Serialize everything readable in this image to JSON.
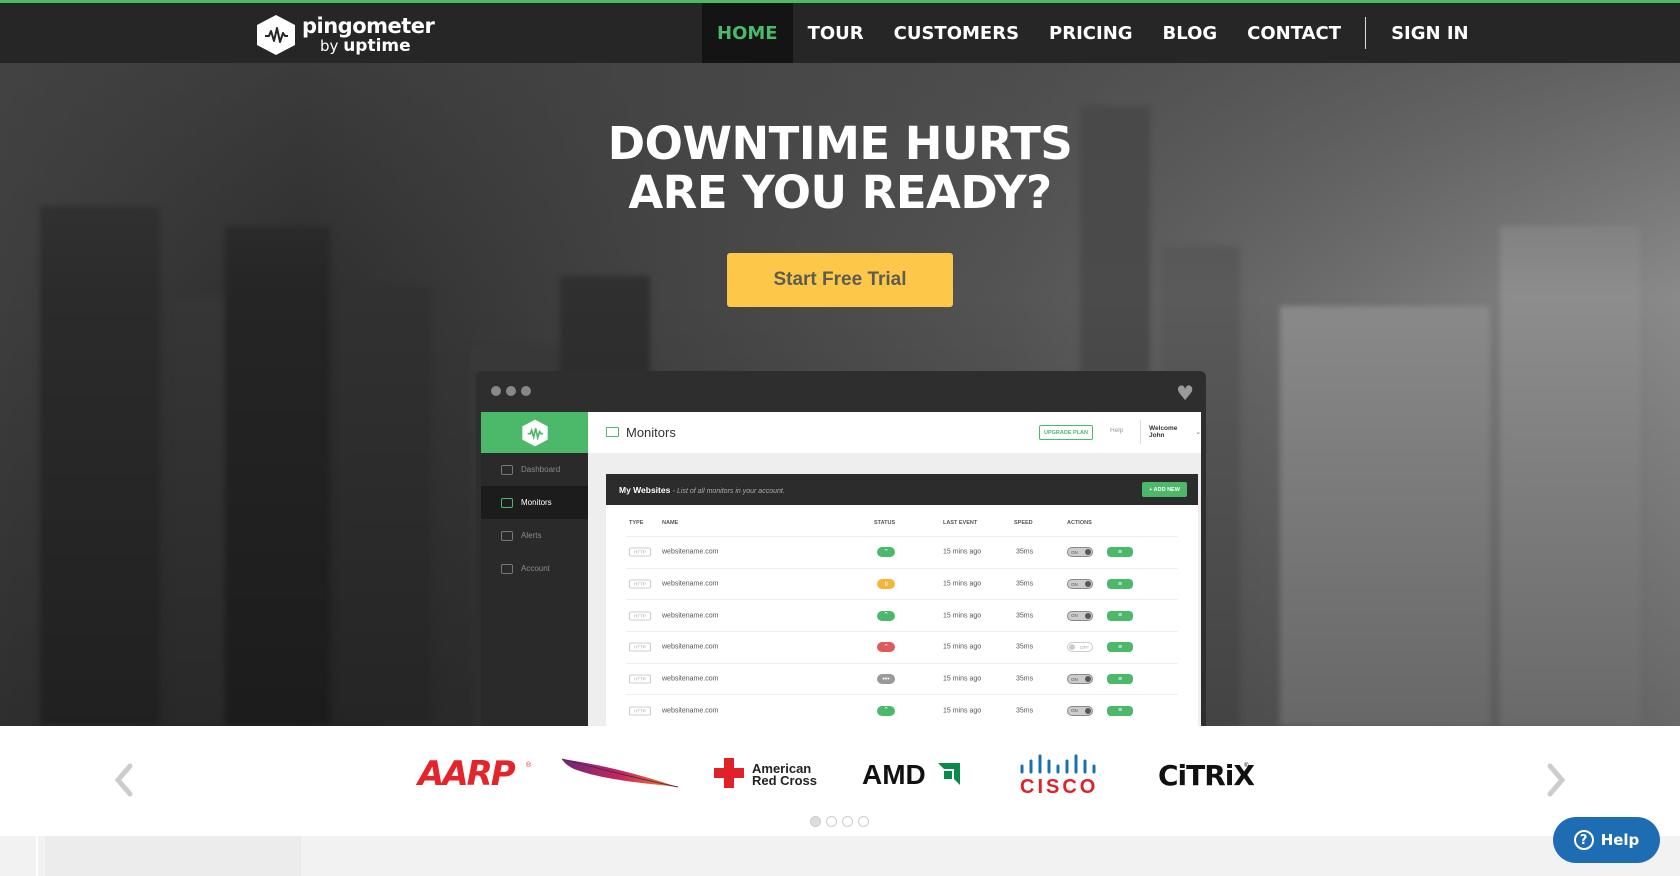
{
  "brand": {
    "name": "pingometer",
    "by": "by",
    "company": "uptime",
    "accent_color": "#4cb96a"
  },
  "nav": {
    "items": [
      {
        "label": "HOME",
        "active": true
      },
      {
        "label": "TOUR",
        "active": false
      },
      {
        "label": "CUSTOMERS",
        "active": false
      },
      {
        "label": "PRICING",
        "active": false
      },
      {
        "label": "BLOG",
        "active": false
      },
      {
        "label": "CONTACT",
        "active": false
      }
    ],
    "sign_in": "SIGN IN"
  },
  "hero": {
    "title_line1": "DOWNTIME HURTS",
    "title_line2": "ARE YOU READY?",
    "cta_label": "Start Free Trial",
    "cta_color": "#fdc84a"
  },
  "app_mockup": {
    "sidebar": [
      {
        "label": "Dashboard",
        "icon": "dashboard-icon",
        "active": false
      },
      {
        "label": "Monitors",
        "icon": "monitor-icon",
        "active": true
      },
      {
        "label": "Alerts",
        "icon": "alerts-icon",
        "active": false
      },
      {
        "label": "Account",
        "icon": "account-icon",
        "active": false
      }
    ],
    "page_title": "Monitors",
    "upgrade_label": "UPGRADE PLAN",
    "help_label": "Help",
    "welcome": "Welcome John",
    "panel_title": "My Websites",
    "panel_subtitle": "- List of all monitors in your account.",
    "add_new": "+ ADD NEW",
    "columns": {
      "type": "TYPE",
      "name": "NAME",
      "status": "STATUS",
      "last_event": "LAST EVENT",
      "speed": "SPEED",
      "actions": "ACTIONS"
    },
    "rows": [
      {
        "type": "HTTP",
        "name": "websitename.com",
        "status": "up",
        "status_color": "#4cb96a",
        "last_event": "15 mins ago",
        "speed": "35ms",
        "toggle": "ON"
      },
      {
        "type": "HTTP",
        "name": "websitename.com",
        "status": "paused",
        "status_color": "#f4b63a",
        "last_event": "15 mins ago",
        "speed": "35ms",
        "toggle": "ON"
      },
      {
        "type": "HTTP",
        "name": "websitename.com",
        "status": "up",
        "status_color": "#4cb96a",
        "last_event": "15 mins ago",
        "speed": "35ms",
        "toggle": "ON"
      },
      {
        "type": "HTTP",
        "name": "websitename.com",
        "status": "down",
        "status_color": "#e05a5a",
        "last_event": "15 mins ago",
        "speed": "35ms",
        "toggle": "OFF"
      },
      {
        "type": "HTTP",
        "name": "websitename.com",
        "status": "pending",
        "status_color": "#9a9a9a",
        "last_event": "15 mins ago",
        "speed": "35ms",
        "toggle": "ON"
      },
      {
        "type": "HTTP",
        "name": "websitename.com",
        "status": "up",
        "status_color": "#4cb96a",
        "last_event": "15 mins ago",
        "speed": "35ms",
        "toggle": "ON"
      }
    ]
  },
  "customers": {
    "logos": [
      {
        "name": "AARP",
        "icon": "aarp-logo"
      },
      {
        "name": "Apache",
        "icon": "apache-feather-logo"
      },
      {
        "name": "American Red Cross",
        "icon": "red-cross-logo"
      },
      {
        "name": "AMD",
        "icon": "amd-logo"
      },
      {
        "name": "CISCO",
        "icon": "cisco-logo"
      },
      {
        "name": "CITRIX",
        "icon": "citrix-logo"
      }
    ],
    "page_count": 4,
    "current_page": 1
  },
  "help_widget": {
    "label": "Help",
    "color": "#1e6db3"
  }
}
